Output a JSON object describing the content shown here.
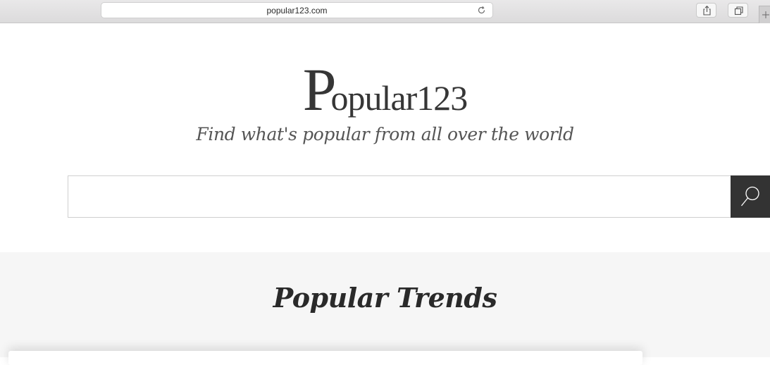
{
  "browser": {
    "url": "popular123.com",
    "icons": {
      "reload": "reload-icon",
      "share": "share-icon",
      "tabs": "tabs-overview-icon",
      "new_tab": "plus-icon"
    }
  },
  "logo": {
    "capital": "P",
    "rest": "opular123"
  },
  "tagline": "Find what's popular from all over the world",
  "search": {
    "value": "",
    "placeholder": "",
    "button_icon": "search-icon"
  },
  "trends": {
    "title": "Popular Trends"
  },
  "colors": {
    "search_button_bg": "#333333",
    "logo_text": "#363636",
    "section_bg": "#f6f6f6"
  }
}
